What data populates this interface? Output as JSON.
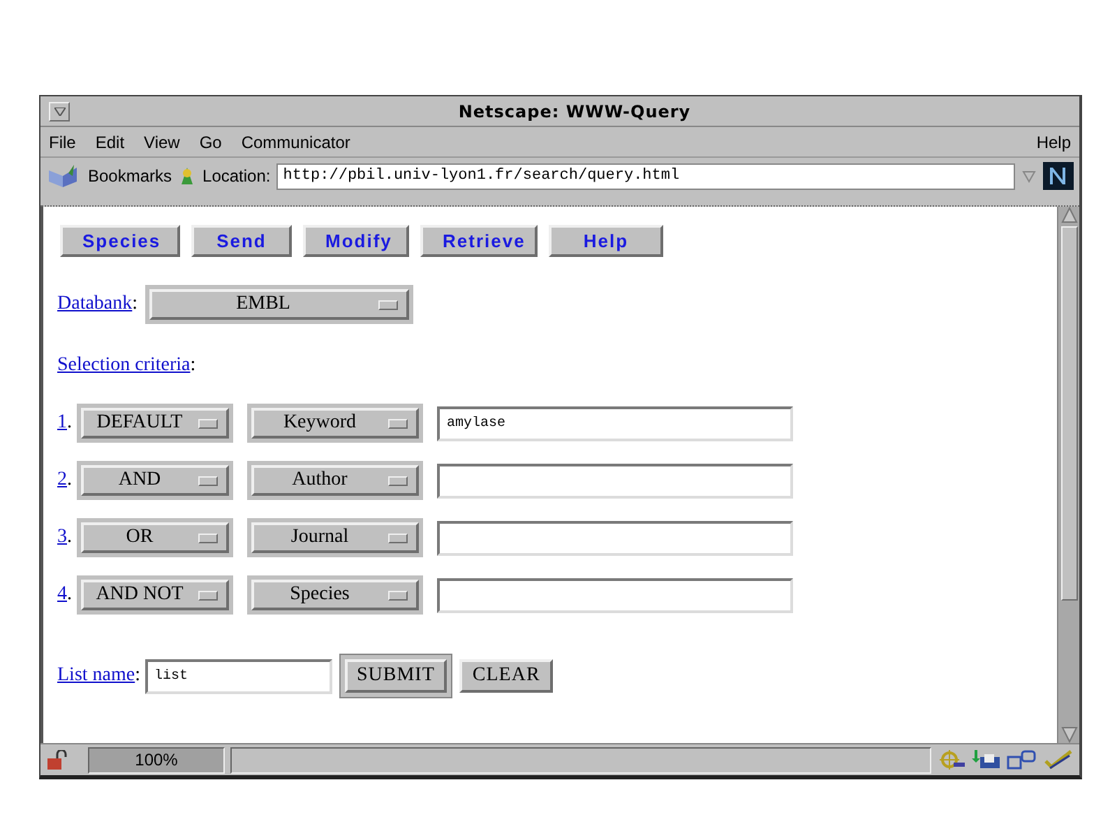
{
  "window": {
    "title": "Netscape: WWW-Query"
  },
  "menu_bar": {
    "items": [
      "File",
      "Edit",
      "View",
      "Go",
      "Communicator"
    ],
    "help": "Help"
  },
  "location_bar": {
    "bookmarks": "Bookmarks",
    "location_label": "Location:",
    "url": "http://pbil.univ-lyon1.fr/search/query.html"
  },
  "page": {
    "nav_buttons": [
      "Species",
      "Send",
      "Modify",
      "Retrieve",
      "Help"
    ],
    "databank": {
      "link": "Databank",
      "after": ":",
      "value": "EMBL"
    },
    "selection": {
      "link": "Selection criteria",
      "after": ":"
    },
    "criteria": [
      {
        "number": "1",
        "after": ".",
        "operator": "DEFAULT",
        "field": "Keyword",
        "value": "amylase"
      },
      {
        "number": "2",
        "after": ".",
        "operator": "AND",
        "field": "Author"
      },
      {
        "number": "3",
        "after": ".",
        "operator": "OR",
        "field": "Journal"
      },
      {
        "number": "4",
        "after": ".",
        "operator": "AND NOT",
        "field": "Species"
      }
    ],
    "list_name": {
      "link": "List name",
      "after": ":",
      "value": "list"
    },
    "buttons": [
      {
        "label": "SUBMIT",
        "default": true
      },
      {
        "label": "CLEAR",
        "default": false
      }
    ]
  },
  "status_bar": {
    "progress": {
      "level": 1,
      "text": "100%"
    }
  }
}
